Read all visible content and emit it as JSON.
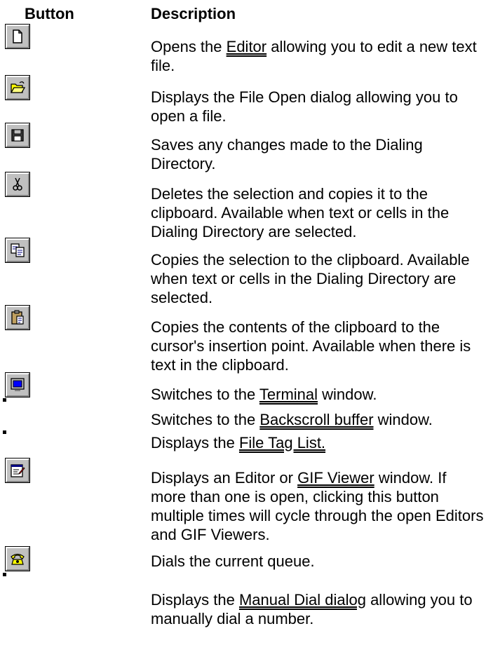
{
  "header": {
    "button_col": "Button",
    "description_col": "Description"
  },
  "rows": [
    {
      "icon": "new-file-icon",
      "text": [
        "Opens the ",
        "Editor",
        " allowing you to edit a new text file."
      ]
    },
    {
      "icon": "open-folder-icon",
      "text": "Displays the File Open dialog allowing you to open a file."
    },
    {
      "icon": "floppy-disk-icon",
      "text": "Saves any changes made to the Dialing Directory."
    },
    {
      "icon": "scissors-icon",
      "text": "Deletes the selection and copies it to the clipboard. Available when text or cells in the Dialing Directory are selected."
    },
    {
      "icon": "copy-icon",
      "text": "Copies the selection to the clipboard. Available when text or cells in the Dialing Directory are selected."
    },
    {
      "icon": "paste-icon",
      "text": "Copies the contents of the clipboard to the cursor's insertion point. Available when there is text in the clipboard."
    },
    {
      "icon": "terminal-monitor-icon",
      "text": [
        "Switches to the ",
        "Terminal",
        " window."
      ]
    },
    {
      "icon": "bullet-icon",
      "text": [
        "Switches to the ",
        "Backscroll buffer",
        " window."
      ]
    },
    {
      "icon": "bullet-icon",
      "text": [
        "Displays the ",
        "File Tag List."
      ]
    },
    {
      "icon": "editor-window-icon",
      "text": [
        "Displays an Editor or ",
        "GIF Viewer",
        " window. If more than one is open, clicking this button multiple times will cycle through the open Editors and GIF Viewers."
      ]
    },
    {
      "icon": "telephone-icon",
      "text": "Dials the current queue."
    },
    {
      "icon": "bullet-icon",
      "text": [
        "Displays the ",
        "Manual Dial dialog",
        " allowing you to manually dial a number."
      ]
    }
  ],
  "colors": {
    "button_face": "#c0c0c0",
    "terminal_blue": "#0000ff",
    "folder_yellow": "#ffff00",
    "phone_yellow": "#ffff00"
  }
}
